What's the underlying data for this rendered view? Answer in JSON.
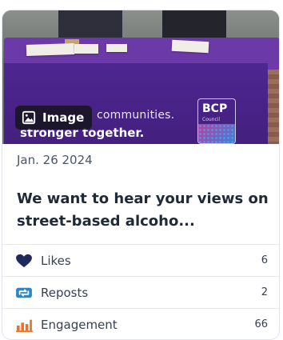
{
  "card": {
    "image_badge_label": "Image",
    "image_text": {
      "line1": "communities.",
      "line2": "stronger together."
    },
    "logo": {
      "text": "BCP",
      "subtext": "Council"
    },
    "date": "Jan. 26 2024",
    "title": "We want to hear your views on street-based alcoho...",
    "metrics": [
      {
        "icon": "heart-icon",
        "label": "Likes",
        "value": "6",
        "color": "#1f2a5c"
      },
      {
        "icon": "repost-icon",
        "label": "Reposts",
        "value": "2",
        "color": "#2a86c9"
      },
      {
        "icon": "engagement-icon",
        "label": "Engagement",
        "value": "66",
        "color": "#e8722c"
      }
    ]
  }
}
